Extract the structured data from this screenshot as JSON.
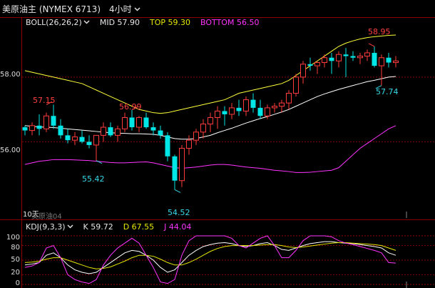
{
  "header": {
    "title": "美原油主 (NYMEX 6713)",
    "period": "4小时"
  },
  "boll_legend": {
    "name": "BOLL(26,26,2)",
    "mid": "MID 57.90",
    "top": "TOP 59.30",
    "bottom": "BOTTOM 56.50"
  },
  "kdj_legend": {
    "name": "KDJ(9,3,3)",
    "k": "K 59.72",
    "d": "D 67.55",
    "j": "J 44.04"
  },
  "price_axis": {
    "t58": "58.00",
    "t56": "56.00"
  },
  "price_annotations": {
    "a1": "57.15",
    "a2": "56.99",
    "a3": "58.95",
    "a4": "55.42",
    "a5": "54.52",
    "a6": "57.74"
  },
  "bottom_label": "10天",
  "symbol_label": "美原油04",
  "kdj_axis": {
    "t100a": "100",
    "t80": "80",
    "t50": "50",
    "t20": "20",
    "t0": "0"
  },
  "colors": {
    "up": "#ff3b3b",
    "down": "#00e5e5",
    "mid": "#ffffff",
    "upper": "#ffff3a",
    "lower": "#ff33ff",
    "grid": "#8a0000",
    "red_label": "#ff4040",
    "cyan_label": "#36d9e8"
  },
  "chart_data": [
    {
      "type": "candlestick",
      "ylim": [
        53.8,
        59.5
      ],
      "ohlc": [
        [
          56.45,
          56.5,
          56.2,
          56.35
        ],
        [
          56.35,
          56.6,
          56.2,
          56.5
        ],
        [
          56.5,
          56.85,
          56.2,
          56.4
        ],
        [
          56.4,
          56.9,
          56.3,
          56.8
        ],
        [
          56.8,
          57.15,
          56.4,
          56.5
        ],
        [
          56.5,
          56.7,
          56.1,
          56.2
        ],
        [
          56.2,
          56.4,
          55.95,
          56.05
        ],
        [
          56.05,
          56.3,
          55.9,
          56.15
        ],
        [
          56.15,
          56.35,
          55.95,
          56.0
        ],
        [
          56.0,
          56.2,
          55.8,
          55.9
        ],
        [
          55.9,
          56.05,
          55.42,
          56.2
        ],
        [
          56.2,
          56.6,
          56.0,
          56.45
        ],
        [
          56.45,
          56.6,
          56.15,
          56.2
        ],
        [
          56.2,
          56.5,
          56.0,
          56.4
        ],
        [
          56.4,
          56.9,
          56.3,
          56.75
        ],
        [
          56.75,
          56.99,
          56.35,
          56.45
        ],
        [
          56.45,
          56.8,
          56.3,
          56.75
        ],
        [
          56.75,
          56.9,
          56.4,
          56.45
        ],
        [
          56.45,
          56.6,
          56.2,
          56.35
        ],
        [
          56.35,
          56.5,
          56.1,
          56.2
        ],
        [
          56.2,
          56.3,
          55.4,
          55.55
        ],
        [
          55.55,
          55.6,
          54.52,
          54.8
        ],
        [
          54.8,
          55.9,
          54.6,
          55.8
        ],
        [
          55.8,
          56.2,
          55.6,
          56.05
        ],
        [
          56.05,
          56.4,
          55.9,
          56.3
        ],
        [
          56.3,
          56.7,
          56.1,
          56.55
        ],
        [
          56.55,
          56.9,
          56.3,
          56.75
        ],
        [
          56.75,
          57.1,
          56.4,
          56.95
        ],
        [
          56.95,
          57.1,
          56.5,
          56.85
        ],
        [
          56.85,
          57.2,
          56.7,
          57.05
        ],
        [
          57.05,
          57.3,
          56.8,
          56.95
        ],
        [
          56.95,
          57.4,
          56.8,
          57.3
        ],
        [
          57.3,
          57.5,
          56.9,
          57.05
        ],
        [
          57.05,
          57.3,
          56.7,
          56.8
        ],
        [
          56.8,
          57.15,
          56.7,
          57.05
        ],
        [
          57.05,
          57.2,
          56.9,
          57.1
        ],
        [
          57.1,
          57.3,
          56.9,
          57.2
        ],
        [
          57.2,
          57.6,
          57.0,
          57.5
        ],
        [
          57.5,
          58.1,
          57.4,
          58.0
        ],
        [
          58.0,
          58.5,
          57.8,
          58.4
        ],
        [
          58.4,
          58.6,
          58.2,
          58.35
        ],
        [
          58.35,
          58.5,
          58.1,
          58.45
        ],
        [
          58.45,
          58.7,
          58.3,
          58.6
        ],
        [
          58.6,
          58.75,
          58.1,
          58.5
        ],
        [
          58.5,
          58.8,
          58.3,
          58.7
        ],
        [
          58.7,
          58.9,
          58.0,
          58.65
        ],
        [
          58.65,
          58.8,
          58.5,
          58.6
        ],
        [
          58.6,
          58.75,
          58.4,
          58.65
        ],
        [
          58.65,
          58.85,
          58.5,
          58.75
        ],
        [
          58.75,
          58.95,
          58.3,
          58.35
        ],
        [
          58.35,
          58.7,
          57.74,
          58.6
        ],
        [
          58.6,
          58.75,
          58.3,
          58.45
        ],
        [
          58.45,
          58.65,
          58.3,
          58.5
        ]
      ],
      "mid": [
        56.5,
        56.48,
        56.46,
        56.45,
        56.44,
        56.42,
        56.4,
        56.38,
        56.36,
        56.34,
        56.32,
        56.3,
        56.28,
        56.27,
        56.26,
        56.25,
        56.25,
        56.24,
        56.23,
        56.2,
        56.15,
        56.1,
        56.08,
        56.08,
        56.1,
        56.15,
        56.2,
        56.28,
        56.35,
        56.42,
        56.5,
        56.58,
        56.65,
        56.72,
        56.78,
        56.85,
        56.92,
        57.0,
        57.1,
        57.2,
        57.3,
        57.4,
        57.48,
        57.55,
        57.62,
        57.68,
        57.74,
        57.8,
        57.86,
        57.9,
        57.95,
        58.0,
        58.02
      ],
      "upper": [
        58.2,
        58.15,
        58.1,
        58.05,
        58.0,
        57.95,
        57.9,
        57.85,
        57.8,
        57.7,
        57.6,
        57.5,
        57.4,
        57.3,
        57.2,
        57.1,
        57.0,
        56.95,
        56.9,
        56.88,
        56.9,
        56.95,
        57.0,
        57.05,
        57.1,
        57.15,
        57.2,
        57.25,
        57.3,
        57.4,
        57.5,
        57.55,
        57.6,
        57.65,
        57.7,
        57.75,
        57.8,
        57.9,
        58.05,
        58.2,
        58.35,
        58.5,
        58.65,
        58.8,
        58.95,
        59.05,
        59.12,
        59.18,
        59.22,
        59.25,
        59.27,
        59.29,
        59.3
      ],
      "lower": [
        55.3,
        55.35,
        55.4,
        55.42,
        55.45,
        55.45,
        55.45,
        55.44,
        55.43,
        55.42,
        55.4,
        55.38,
        55.36,
        55.35,
        55.35,
        55.36,
        55.37,
        55.38,
        55.35,
        55.3,
        55.25,
        55.2,
        55.18,
        55.2,
        55.22,
        55.25,
        55.28,
        55.3,
        55.3,
        55.28,
        55.25,
        55.22,
        55.2,
        55.18,
        55.15,
        55.12,
        55.1,
        55.08,
        55.05,
        55.05,
        55.06,
        55.08,
        55.1,
        55.12,
        55.2,
        55.4,
        55.6,
        55.8,
        55.95,
        56.1,
        56.25,
        56.4,
        56.5
      ]
    },
    {
      "type": "line",
      "ylim": [
        0,
        100
      ],
      "series": [
        {
          "name": "K",
          "values": [
            40,
            42,
            45,
            60,
            65,
            55,
            40,
            30,
            25,
            22,
            25,
            35,
            45,
            55,
            65,
            70,
            68,
            60,
            50,
            35,
            25,
            30,
            45,
            60,
            70,
            78,
            82,
            85,
            86,
            84,
            80,
            78,
            80,
            84,
            86,
            80,
            72,
            70,
            75,
            80,
            84,
            86,
            88,
            88,
            86,
            85,
            84,
            82,
            80,
            78,
            75,
            65,
            60
          ]
        },
        {
          "name": "D",
          "values": [
            45,
            46,
            48,
            52,
            55,
            55,
            50,
            45,
            40,
            35,
            32,
            33,
            36,
            42,
            48,
            55,
            60,
            60,
            58,
            52,
            45,
            40,
            40,
            45,
            52,
            60,
            68,
            74,
            78,
            80,
            80,
            80,
            80,
            81,
            82,
            82,
            80,
            77,
            76,
            77,
            79,
            81,
            83,
            85,
            86,
            86,
            85,
            84,
            83,
            82,
            80,
            75,
            70
          ]
        },
        {
          "name": "J",
          "values": [
            35,
            38,
            45,
            75,
            80,
            55,
            20,
            10,
            5,
            2,
            10,
            40,
            60,
            75,
            85,
            95,
            85,
            60,
            35,
            5,
            2,
            10,
            60,
            90,
            100,
            100,
            100,
            100,
            100,
            95,
            80,
            75,
            85,
            95,
            100,
            80,
            55,
            55,
            70,
            90,
            100,
            100,
            100,
            98,
            90,
            85,
            82,
            78,
            74,
            70,
            65,
            45,
            44
          ]
        }
      ]
    }
  ]
}
